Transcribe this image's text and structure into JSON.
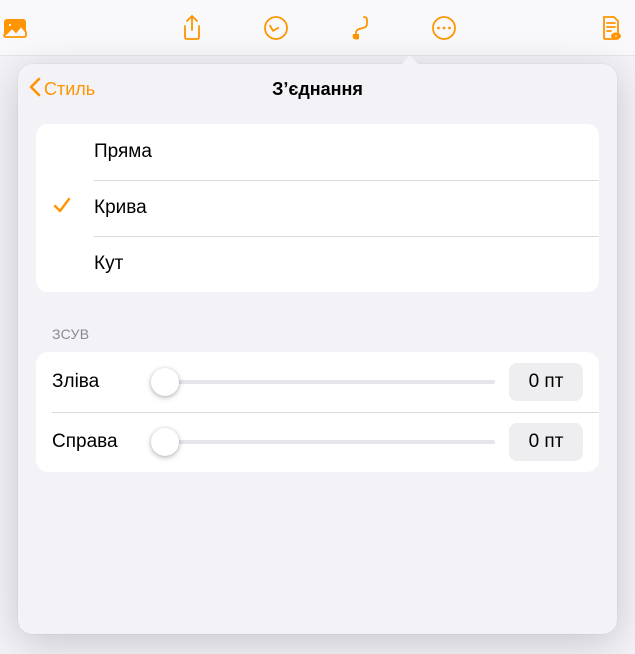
{
  "toolbar": {
    "icons": {
      "media": "media-icon",
      "share": "share-icon",
      "undo": "undo-icon",
      "format": "format-brush-icon",
      "more": "more-icon",
      "document": "document-icon"
    }
  },
  "popover": {
    "back_label": "Стиль",
    "title": "Зʼєднання",
    "connection_types": [
      {
        "label": "Пряма",
        "selected": false
      },
      {
        "label": "Крива",
        "selected": true
      },
      {
        "label": "Кут",
        "selected": false
      }
    ],
    "offset_section": {
      "header": "ЗСУВ",
      "rows": [
        {
          "label": "Зліва",
          "value": "0 пт"
        },
        {
          "label": "Справа",
          "value": "0 пт"
        }
      ]
    }
  }
}
